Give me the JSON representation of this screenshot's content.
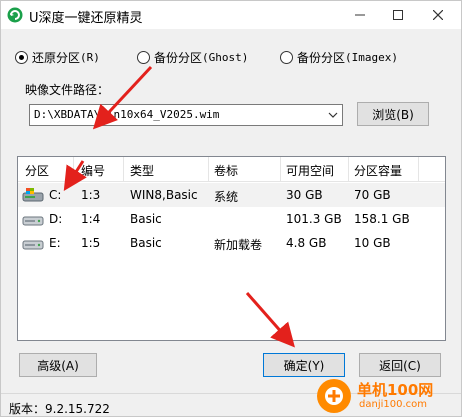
{
  "window": {
    "title": "U深度一键还原精灵",
    "controls": {
      "minimize": "—",
      "maximize": "☐",
      "close": "✕"
    }
  },
  "modes": [
    {
      "label_cn": "还原分区",
      "label_en": "(R)",
      "checked": true
    },
    {
      "label_cn": "备份分区",
      "label_en": "(Ghost)",
      "checked": false
    },
    {
      "label_cn": "备份分区",
      "label_en": "(Imagex)",
      "checked": false
    }
  ],
  "image_path": {
    "label": "映像文件路径：",
    "value": "D:\\XBDATA\\Win10x64_V2025.wim",
    "browse_label": "浏览(B)"
  },
  "table": {
    "columns": [
      "分区",
      "编号",
      "类型",
      "卷标",
      "可用空间",
      "分区容量"
    ],
    "rows": [
      {
        "partition": "C:",
        "number": "1:3",
        "type": "WIN8,Basic",
        "label": "系统",
        "free": "30 GB",
        "capacity": "70 GB",
        "selected": true,
        "icon": "system-disk-icon"
      },
      {
        "partition": "D:",
        "number": "1:4",
        "type": "Basic",
        "label": "",
        "free": "101.3 GB",
        "capacity": "158.1 GB",
        "selected": false,
        "icon": "disk-icon"
      },
      {
        "partition": "E:",
        "number": "1:5",
        "type": "Basic",
        "label": "新加载卷",
        "free": "4.8 GB",
        "capacity": "10 GB",
        "selected": false,
        "icon": "disk-icon"
      }
    ]
  },
  "buttons": {
    "advanced": "高级(A)",
    "ok": "确定(Y)",
    "back": "返回(C)"
  },
  "status": {
    "version": "版本：9.2.15.722"
  },
  "watermark": {
    "line1": "单机100网",
    "line2": "danji100.com"
  },
  "colors": {
    "annotation_arrow": "#e3211c",
    "accent_border": "#0078d7",
    "watermark": "#ff7a00"
  }
}
